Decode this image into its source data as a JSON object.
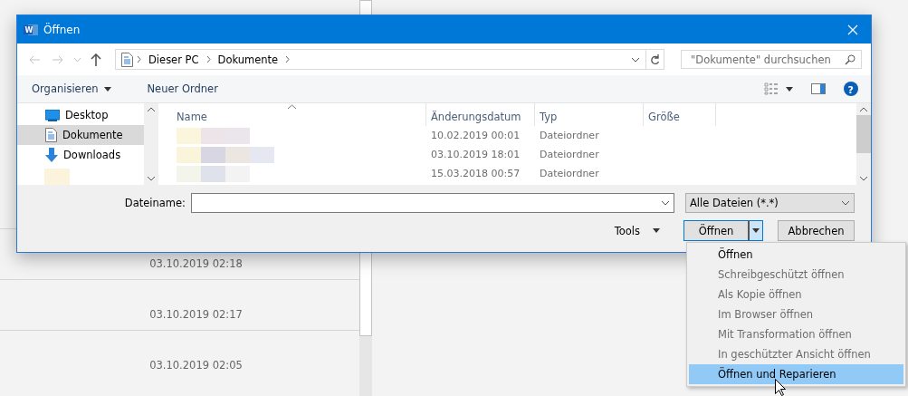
{
  "window": {
    "title": "Öffnen",
    "app_logo_letter": "W"
  },
  "help": {
    "glyph": "?"
  },
  "address_bar": {
    "path": [
      "Dieser PC",
      "Dokumente"
    ]
  },
  "search": {
    "placeholder": "\"Dokumente\" durchsuchen"
  },
  "toolbar": {
    "buttons": [
      {
        "label": "Organisieren",
        "has_menu": true
      },
      {
        "label": "Neuer Ordner",
        "has_menu": false
      }
    ]
  },
  "nav_pane": {
    "items": [
      {
        "label": "Desktop",
        "selected": false,
        "kind": "desktop"
      },
      {
        "label": "Dokumente",
        "selected": true,
        "kind": "documents"
      },
      {
        "label": "Downloads",
        "selected": false,
        "kind": "downloads"
      }
    ]
  },
  "file_list": {
    "columns": [
      "Name",
      "Änderungsdatum",
      "Typ",
      "Größe"
    ],
    "rows": [
      {
        "modified": "10.02.2019 00:01",
        "type": "Dateiordner"
      },
      {
        "modified": "03.10.2019 18:01",
        "type": "Dateiordner"
      },
      {
        "modified": "15.03.2018 00:57",
        "type": "Dateiordner"
      }
    ]
  },
  "filename": {
    "label": "Dateiname:"
  },
  "file_type": {
    "value": "Alle Dateien (*.*)"
  },
  "tools": {
    "label": "Tools"
  },
  "buttons": {
    "open": "Öffnen",
    "cancel": "Abbrechen"
  },
  "open_menu": [
    {
      "label": "Öffnen",
      "disabled": false,
      "selected": false
    },
    {
      "label": "Schreibgeschützt öffnen",
      "disabled": true,
      "selected": false
    },
    {
      "label": "Als Kopie öffnen",
      "disabled": true,
      "selected": false
    },
    {
      "label": "Im Browser öffnen",
      "disabled": true,
      "selected": false
    },
    {
      "label": "Mit Transformation öffnen",
      "disabled": true,
      "selected": false
    },
    {
      "label": "In geschützter Ansicht öffnen",
      "disabled": true,
      "selected": false
    },
    {
      "label": "Öffnen und Reparieren",
      "disabled": false,
      "selected": true
    }
  ],
  "background": {
    "rows": [
      "03.10.2019 02:18",
      "03.10.2019 02:17",
      "03.10.2019 02:05"
    ]
  }
}
